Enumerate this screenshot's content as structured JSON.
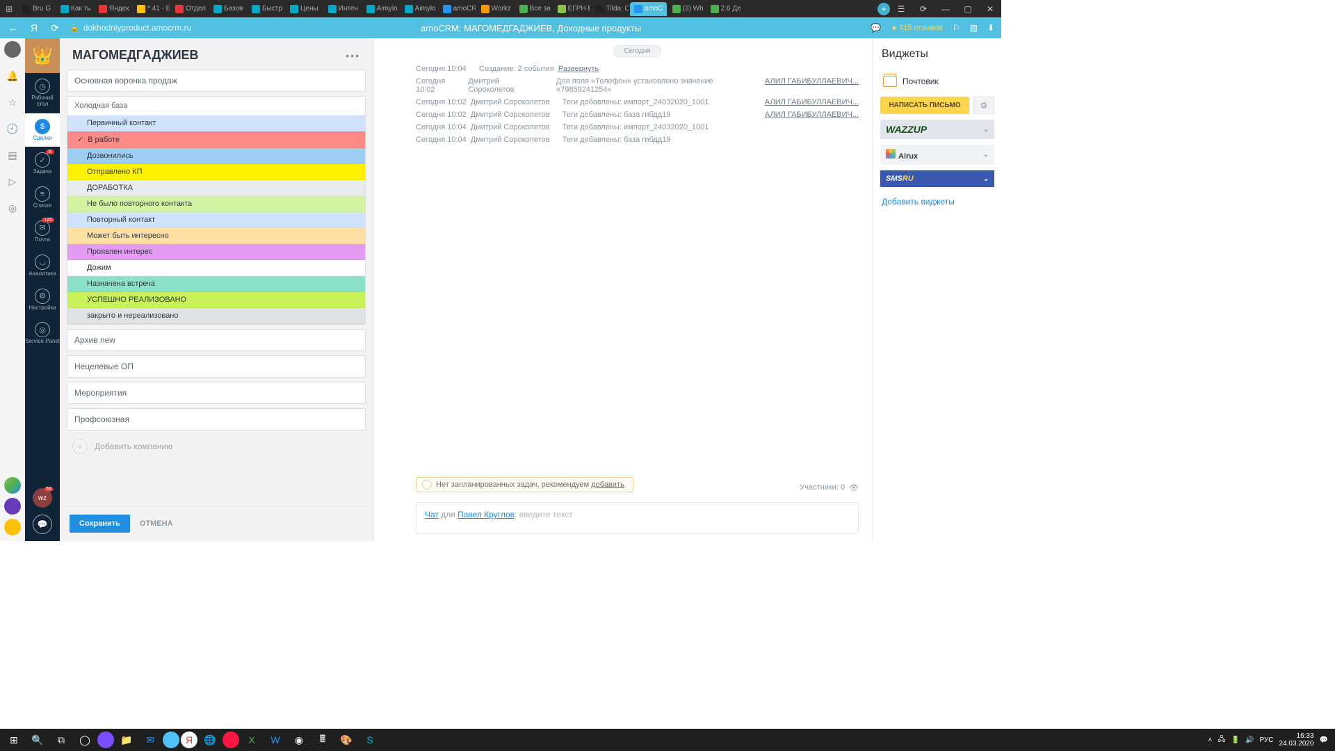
{
  "browser": {
    "tabs": [
      {
        "label": "Bru G",
        "icon": "dark"
      },
      {
        "label": "Как ть",
        "icon": "teal"
      },
      {
        "label": "Яндек",
        "icon": "red"
      },
      {
        "label": "* 41 - Е",
        "icon": "yellow"
      },
      {
        "label": "Отдел",
        "icon": "red"
      },
      {
        "label": "Базов",
        "icon": "teal"
      },
      {
        "label": "Быстр",
        "icon": "teal"
      },
      {
        "label": "Цены",
        "icon": "teal"
      },
      {
        "label": "Интен",
        "icon": "teal"
      },
      {
        "label": "Aimylo",
        "icon": "teal"
      },
      {
        "label": "Aimylo",
        "icon": "teal"
      },
      {
        "label": "amoCR",
        "icon": "blue"
      },
      {
        "label": "Workz",
        "icon": "orange"
      },
      {
        "label": "Все за",
        "icon": "green"
      },
      {
        "label": "ЕГРН Е",
        "icon": "lime"
      },
      {
        "label": "Tilda: С",
        "icon": "dark"
      },
      {
        "label": "amoC",
        "icon": "blue",
        "active": true
      },
      {
        "label": "(3) Wh",
        "icon": "green"
      },
      {
        "label": "2.6 Де",
        "icon": "green"
      }
    ],
    "url": "dokhodniyproduct.amocrm.ru",
    "title": "amoCRM: МАГОМЕДГАДЖИЕВ, Доходные продукты",
    "reviews": "315 отзывов"
  },
  "amo_nav": [
    {
      "label": "Рабочий стол",
      "badge": ""
    },
    {
      "label": "Сделки",
      "active": true
    },
    {
      "label": "Задачи",
      "badge": "8"
    },
    {
      "label": "Списки"
    },
    {
      "label": "Почта",
      "badge": "125"
    },
    {
      "label": "Аналитика"
    },
    {
      "label": "Настройки"
    },
    {
      "label": "Service Panel"
    }
  ],
  "amo_bottom_badge": "59",
  "deal": {
    "title": "МАГОМЕДГАДЖИЕВ",
    "pipeline": "Основная воронка продаж",
    "stage_head": "Холодная база",
    "stages": [
      {
        "label": "Первичный контакт",
        "color": "#cfe3ff"
      },
      {
        "label": "В работе",
        "color": "#fe8b87",
        "selected": true
      },
      {
        "label": "Дозвонились",
        "color": "#9ecdf3"
      },
      {
        "label": "Отправлено КП",
        "color": "#fff200"
      },
      {
        "label": "ДОРАБОТКА",
        "color": "#e8ecef"
      },
      {
        "label": "Не было повторного контакта",
        "color": "#d3f3a3"
      },
      {
        "label": "Повторный контакт",
        "color": "#cfe3ff"
      },
      {
        "label": "Может быть интересно",
        "color": "#ffe0a3"
      },
      {
        "label": "Проявлен интерес",
        "color": "#e39cf2"
      },
      {
        "label": "Дожим",
        "color": "#ffffff"
      },
      {
        "label": "Назначена встреча",
        "color": "#8ce2c7"
      },
      {
        "label": "УСПЕШНО РЕАЛИЗОВАНО",
        "color": "#c9f158"
      },
      {
        "label": "закрыто и нереализовано",
        "color": "#e0e3e6"
      }
    ],
    "extra": [
      "Архив new",
      "Нецелевые ОП",
      "Мероприятия",
      "Профсоюзная"
    ],
    "add_company": "Добавить компанию",
    "save": "Сохранить",
    "cancel": "ОТМЕНА"
  },
  "feed": {
    "day": "Сегодня",
    "rows": [
      {
        "ts": "Сегодня 10:04",
        "user": "",
        "msg": "Создание: 2 события",
        "link": "Развернуть"
      },
      {
        "ts": "Сегодня 10:02",
        "user": "Дмитрий Сороколетов",
        "msg": "Для поля «Телефон» установлено значение «79859241254»",
        "contact": "АЛИЛ ГАБИБУЛЛАЕВИЧ..."
      },
      {
        "ts": "Сегодня 10:02",
        "user": "Дмитрий Сороколетов",
        "msg": "Теги добавлены: импорт_24032020_1001",
        "contact": "АЛИЛ ГАБИБУЛЛАЕВИЧ..."
      },
      {
        "ts": "Сегодня 10:02",
        "user": "Дмитрий Сороколетов",
        "msg": "Теги добавлены: база гибдд19",
        "contact": "АЛИЛ ГАБИБУЛЛАЕВИЧ..."
      },
      {
        "ts": "Сегодня 10:04",
        "user": "Дмитрий Сороколетов",
        "msg": "Теги добавлены: импорт_24032020_1001"
      },
      {
        "ts": "Сегодня 10:04",
        "user": "Дмитрий Сороколетов",
        "msg": "Теги добавлены: база гибдд19"
      }
    ],
    "task_hint_pre": "Нет запланированных задач, рекомендуем ",
    "task_hint_link": "добавить",
    "participants_label": "Участники: 0",
    "chat_label": "Чат",
    "chat_for": " для ",
    "chat_whom": "Павел Круглов",
    "chat_placeholder": ": введите текст"
  },
  "widgets": {
    "title": "Виджеты",
    "mail": "Почтовик",
    "write": "НАПИСАТЬ ПИСЬМО",
    "wazzup": "WAZZUP",
    "airux": "Airux",
    "sms": "SMS",
    "sms_ru": "RU",
    "add": "Добавить виджеты"
  },
  "tray": {
    "lang": "РУС",
    "time": "16:33",
    "date": "24.03.2020"
  }
}
